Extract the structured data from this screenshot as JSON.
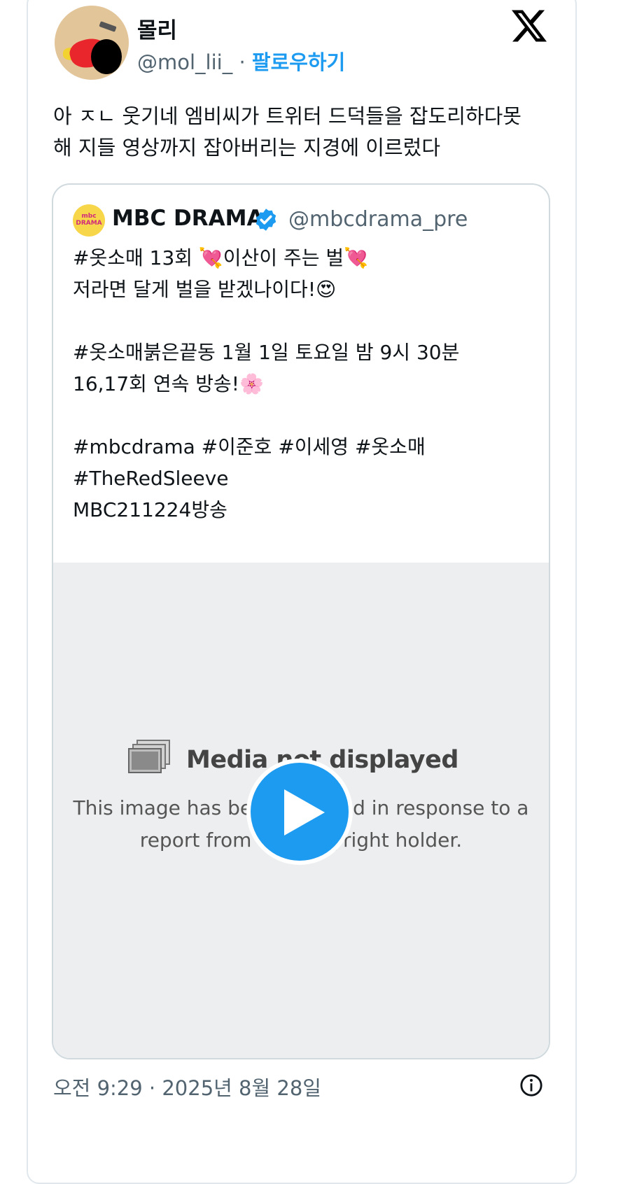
{
  "author": {
    "name": "몰리",
    "handle": "@mol_lii_",
    "separator": "·",
    "follow_label": "팔로우하기"
  },
  "tweet": {
    "lines": [
      "아 ㅈㄴ 웃기네 엠비씨가 트위터 드덕들을 잡도리하다못",
      "해 지들 영상까지 잡아버리는 지경에 이르렀다"
    ]
  },
  "quote": {
    "logo_text": "mbc DRAMA",
    "name": "MBC DRAMA",
    "handle": "@mbcdrama_pre",
    "lines": [
      "#옷소매 13회 💘이산이 주는 벌💘",
      "저라면 달게 벌을 받겠나이다!😍",
      "",
      "#옷소매붉은끝동 1월 1일 토요일 밤 9시 30분",
      "16,17회 연속 방송!🌸",
      "",
      "#mbcdrama #이준호 #이세영 #옷소매",
      "#TheRedSleeve",
      "MBC211224방송"
    ],
    "media": {
      "title": "Media not displayed",
      "line1": "This image has been disabled in response to a",
      "line2": "report from the copyright holder."
    }
  },
  "footer": {
    "timestamp": "오전 9:29 · 2025년 8월 28일"
  },
  "icons": {
    "x_logo": "x-logo-icon",
    "verified": "verified-badge-icon",
    "play": "play-icon",
    "info": "info-icon"
  },
  "colors": {
    "accent": "#1d9bf0",
    "muted": "#536471",
    "border": "#cfd9de",
    "media_bg": "#eceeef"
  }
}
